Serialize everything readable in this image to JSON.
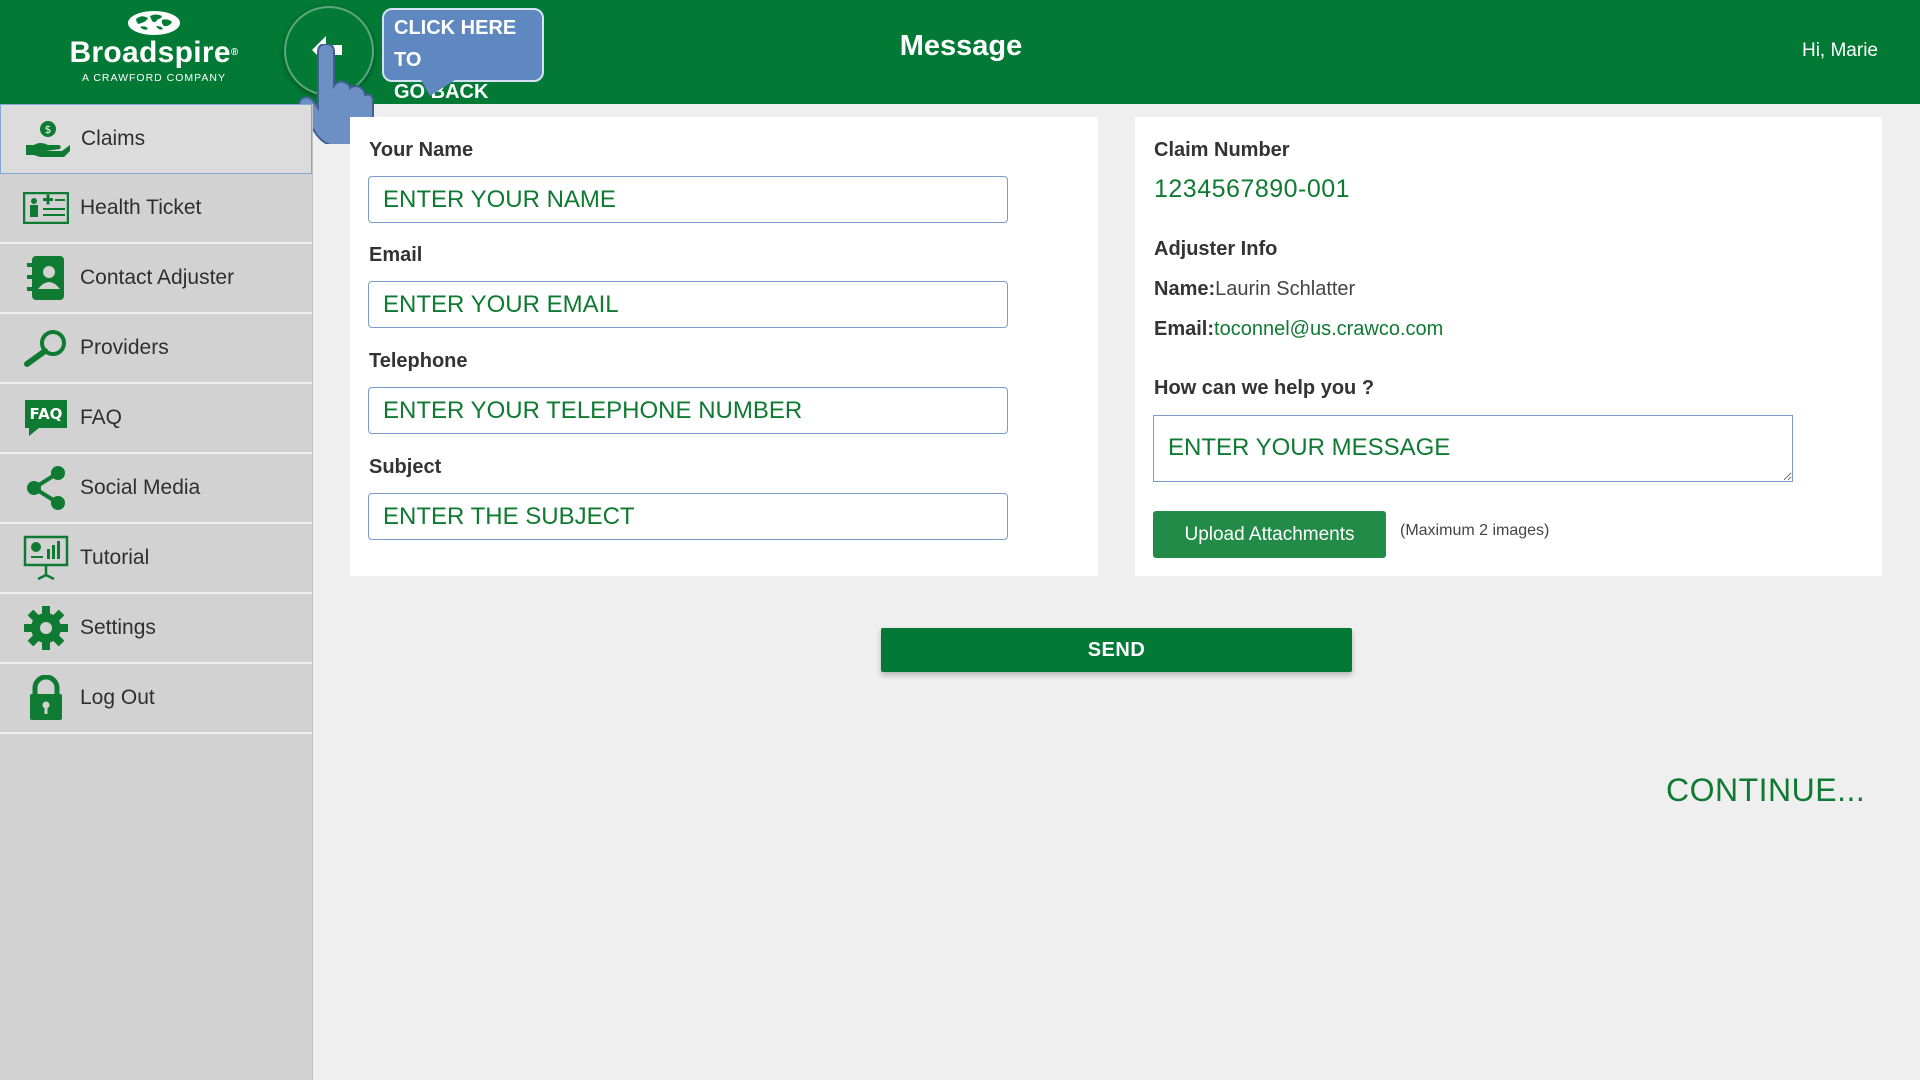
{
  "header": {
    "brand": "Broadspire",
    "brand_mark": "®",
    "brand_sub": "A CRAWFORD COMPANY",
    "title": "Message",
    "greeting": "Hi, Marie",
    "back_tip": [
      "CLICK HERE TO",
      "GO BACK"
    ]
  },
  "sidebar": {
    "items": [
      {
        "label": "Claims",
        "icon": "hand-money-icon"
      },
      {
        "label": "Health Ticket",
        "icon": "health-ticket-icon"
      },
      {
        "label": "Contact Adjuster",
        "icon": "contact-book-icon"
      },
      {
        "label": "Providers",
        "icon": "magnifier-icon"
      },
      {
        "label": "FAQ",
        "icon": "faq-icon"
      },
      {
        "label": "Social Media",
        "icon": "share-icon"
      },
      {
        "label": "Tutorial",
        "icon": "presentation-icon"
      },
      {
        "label": "Settings",
        "icon": "gear-icon"
      },
      {
        "label": "Log Out",
        "icon": "lock-icon"
      }
    ]
  },
  "form": {
    "name_label": "Your Name",
    "name_placeholder": "ENTER YOUR NAME",
    "email_label": "Email",
    "email_placeholder": "ENTER YOUR EMAIL",
    "phone_label": "Telephone",
    "phone_placeholder": "ENTER YOUR TELEPHONE NUMBER",
    "subject_label": "Subject",
    "subject_placeholder": "ENTER THE SUBJECT"
  },
  "claim": {
    "number_label": "Claim Number",
    "number": "1234567890-001",
    "adjuster_label": "Adjuster Info",
    "name_key": "Name:",
    "name_value": "Laurin Schlatter",
    "email_key": "Email:",
    "email_value": "toconnel@us.crawco.com",
    "help_label": "How can we help you ?",
    "message_placeholder": "ENTER YOUR MESSAGE",
    "upload_label": "Upload Attachments",
    "max_note": "(Maximum 2 images)"
  },
  "actions": {
    "send": "SEND",
    "continue": "CONTINUE..."
  },
  "colors": {
    "brand_green": "#027a35",
    "text_green": "#0f7a32",
    "callout_blue": "#5f87c0"
  }
}
